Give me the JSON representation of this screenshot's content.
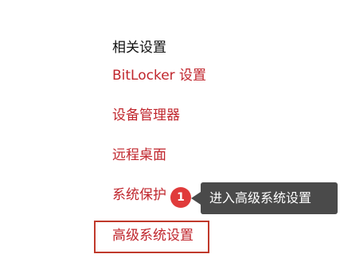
{
  "related_settings": {
    "title": "相关设置",
    "links": {
      "bitlocker": "BitLocker 设置",
      "device_manager": "设备管理器",
      "remote_desktop": "远程桌面",
      "system_protection": "系统保护",
      "advanced_system_settings": "高级系统设置"
    }
  },
  "annotation": {
    "step_number": "1",
    "tooltip_text": "进入高级系统设置",
    "badge_color": "#e03b3b",
    "highlight_color": "#c0392b"
  },
  "colors": {
    "link": "#c0262d",
    "tooltip_bg": "#4a4a4a"
  }
}
